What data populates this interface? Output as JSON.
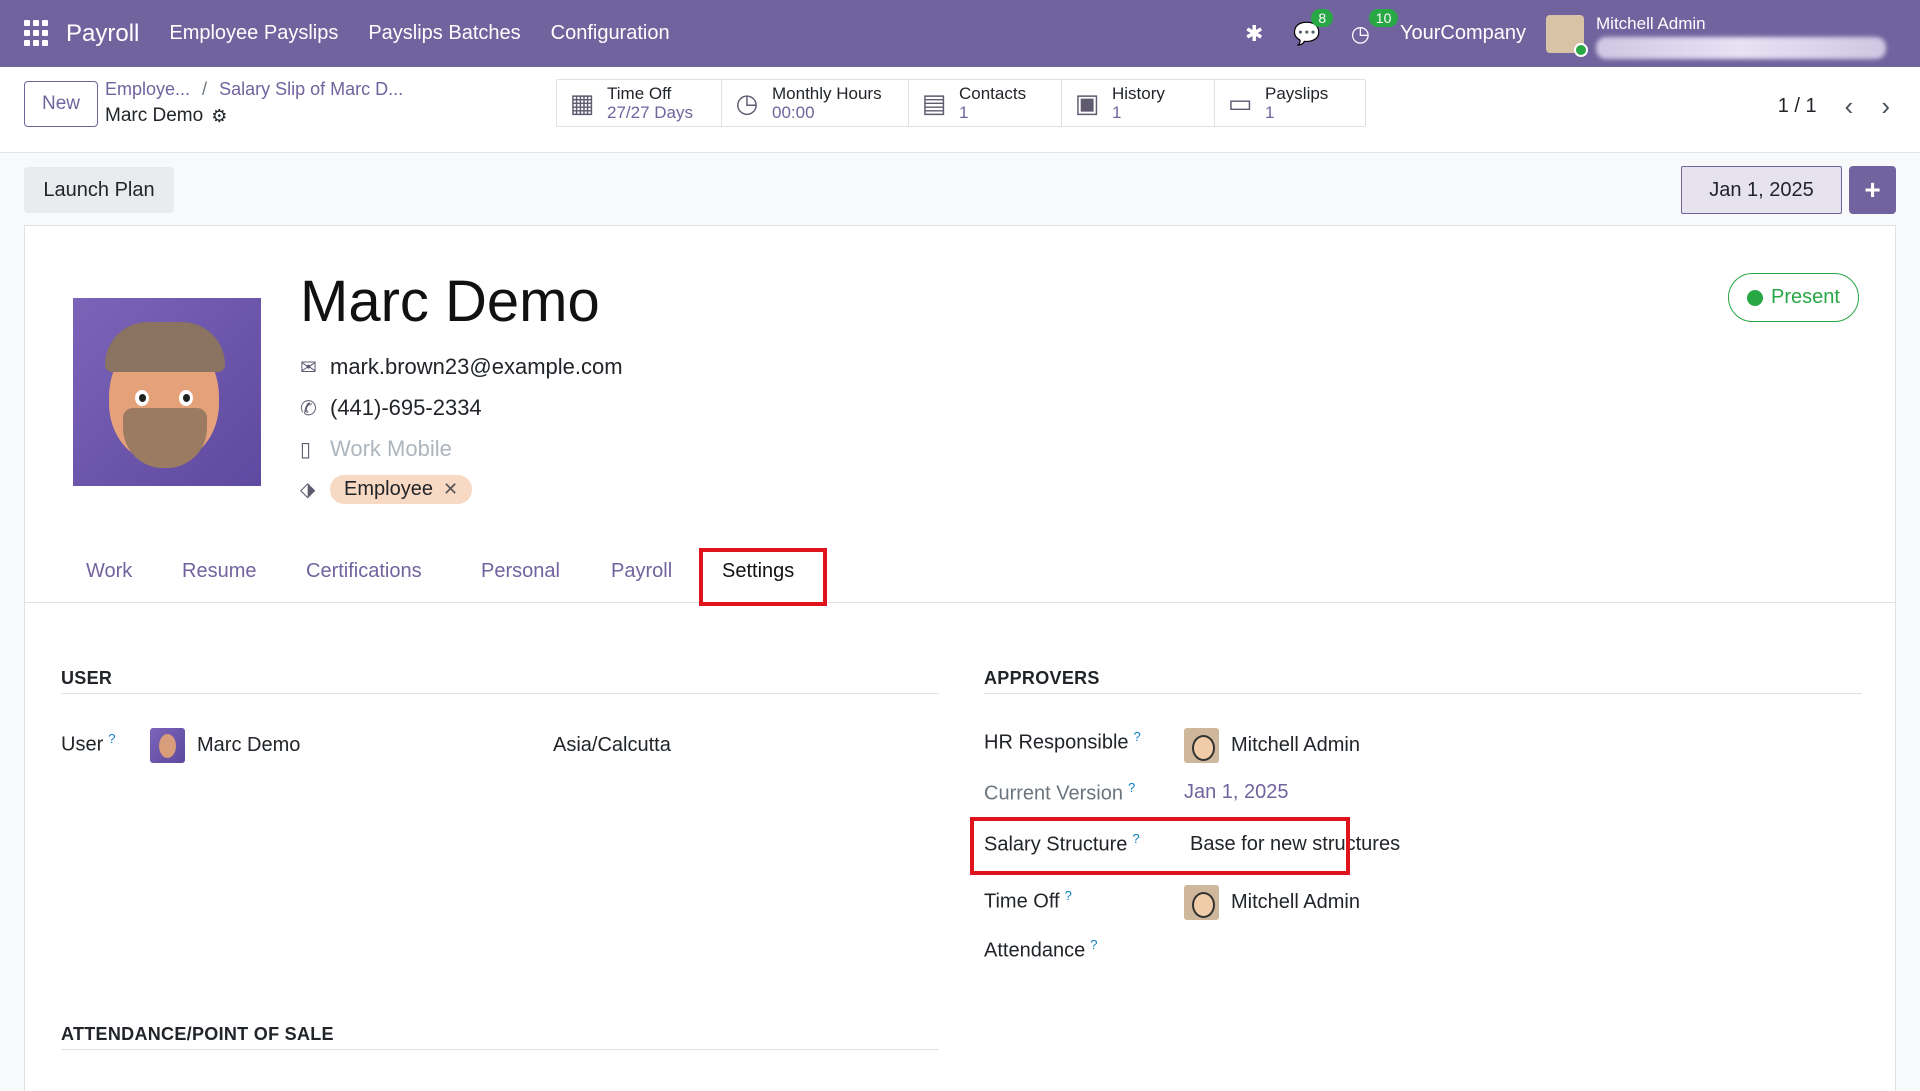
{
  "navbar": {
    "app_name": "Payroll",
    "menu": [
      "Employee Payslips",
      "Payslips Batches",
      "Configuration"
    ],
    "messages_count": "8",
    "activities_count": "10",
    "company": "YourCompany",
    "user_name": "Mitchell Admin"
  },
  "control": {
    "new_label": "New",
    "breadcrumb": [
      "Employe...",
      "Salary Slip of Marc D..."
    ],
    "current_record": "Marc Demo",
    "smart_buttons": [
      {
        "title": "Time Off",
        "value": "27/27 Days",
        "icon": "calendar-icon"
      },
      {
        "title": "Monthly Hours",
        "value": "00:00",
        "icon": "clock-icon"
      },
      {
        "title": "Contacts",
        "value": "1",
        "icon": "id-card-icon"
      },
      {
        "title": "History",
        "value": "1",
        "icon": "user-history-icon"
      },
      {
        "title": "Payslips",
        "value": "1",
        "icon": "money-icon"
      }
    ],
    "pager": "1 / 1"
  },
  "status": {
    "launch_plan": "Launch Plan",
    "version_date": "Jan 1, 2025",
    "add_label": "+"
  },
  "employee": {
    "name": "Marc Demo",
    "email": "mark.brown23@example.com",
    "phone": "(441)-695-2334",
    "work_mobile_placeholder": "Work Mobile",
    "tag": "Employee",
    "presence": "Present"
  },
  "tabs": [
    "Work",
    "Resume",
    "Certifications",
    "Personal",
    "Payroll",
    "Settings"
  ],
  "settings": {
    "user_section": "USER",
    "user_label": "User",
    "user_value": "Marc Demo",
    "timezone": "Asia/Calcutta",
    "approvers_section": "APPROVERS",
    "hr_label": "HR Responsible",
    "hr_value": "Mitchell Admin",
    "version_label": "Current Version",
    "version_value": "Jan 1, 2025",
    "salary_label": "Salary Structure",
    "salary_value": "Base for new structures",
    "timeoff_label": "Time Off",
    "timeoff_value": "Mitchell Admin",
    "attendance_label": "Attendance",
    "attendance_section": "ATTENDANCE/POINT OF SALE",
    "help_mark": "?"
  },
  "colors": {
    "brand": "#71639e",
    "success": "#28a745",
    "highlight": "#e0121c"
  }
}
